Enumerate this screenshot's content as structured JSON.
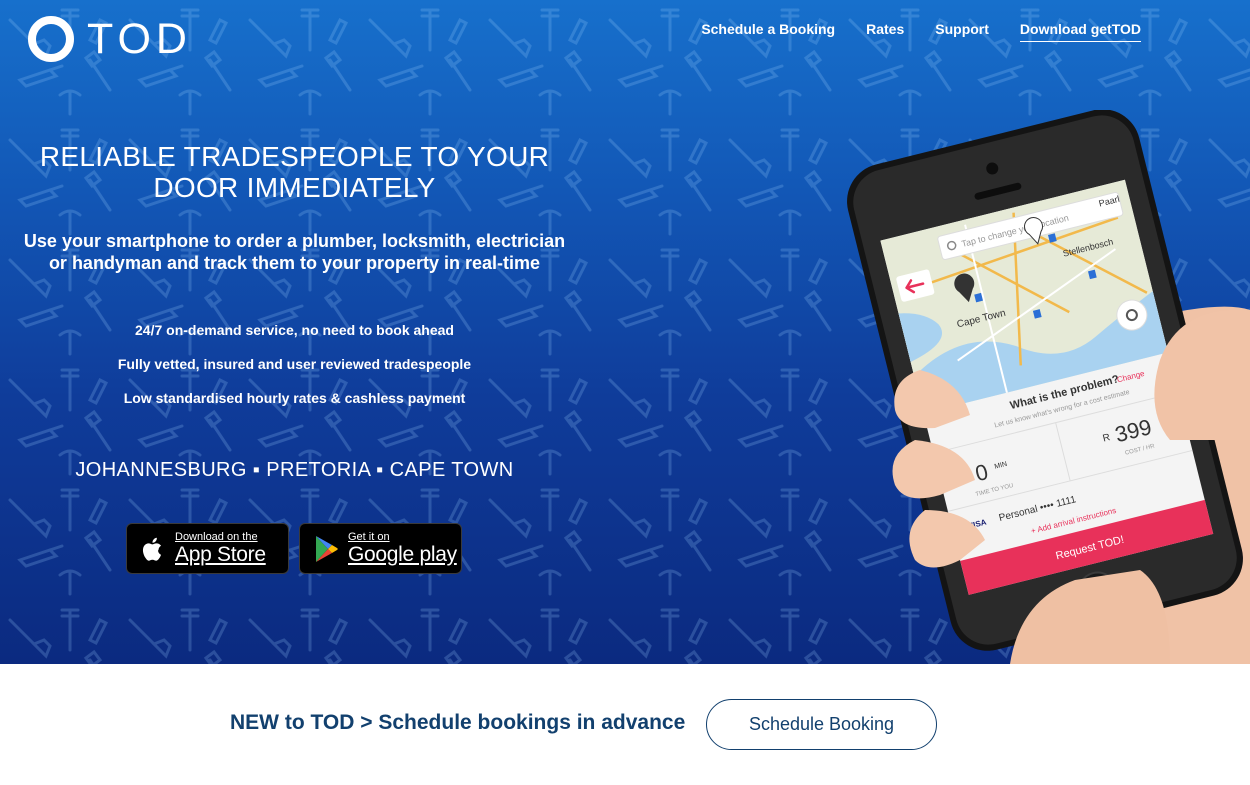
{
  "brand": {
    "name": "TOD"
  },
  "nav": {
    "items": [
      {
        "label": "Schedule a Booking"
      },
      {
        "label": "Rates"
      },
      {
        "label": "Support"
      },
      {
        "label": "Download getTOD"
      }
    ]
  },
  "hero": {
    "headline": "RELIABLE TRADESPEOPLE TO YOUR DOOR IMMEDIATELY",
    "subheadline": "Use your smartphone to order a plumber, locksmith, electrician or handyman and track them to your property in real-time",
    "features": [
      "24/7 on-demand service, no need to book ahead",
      "Fully vetted, insured and user reviewed tradespeople",
      "Low standardised hourly rates & cashless payment"
    ],
    "cities": "JOHANNESBURG ▪ PRETORIA ▪ CAPE TOWN",
    "app_store": {
      "small": "Download on the",
      "big": "App Store"
    },
    "google_play": {
      "small": "Get it on",
      "big": "Google play"
    }
  },
  "phone_screen": {
    "search_placeholder": "Tap to change your location",
    "map_labels": [
      "Cape Town",
      "Stellenbosch",
      "Paarl"
    ],
    "problem_label": "What is the problem?",
    "problem_change": "Change",
    "problem_hint": "Let us know what's wrong for a cost estimate",
    "price": "399",
    "price_currency": "R",
    "price_sub": "COST / HR",
    "eta_value": "0",
    "eta_unit": "MIN",
    "eta_sub": "TIME TO YOU",
    "payment_brand": "VISA",
    "payment_label": "Personal •••• 1111",
    "arrival_instructions": "+ Add arrival instructions",
    "request_button": "Request TOD!"
  },
  "cta": {
    "text": "NEW to TOD > Schedule bookings in advance",
    "button": "Schedule Booking"
  },
  "colors": {
    "hero_top": "#1770cc",
    "hero_bottom": "#0b2a80",
    "cta_text": "#12406e",
    "request_button": "#e8315a"
  }
}
